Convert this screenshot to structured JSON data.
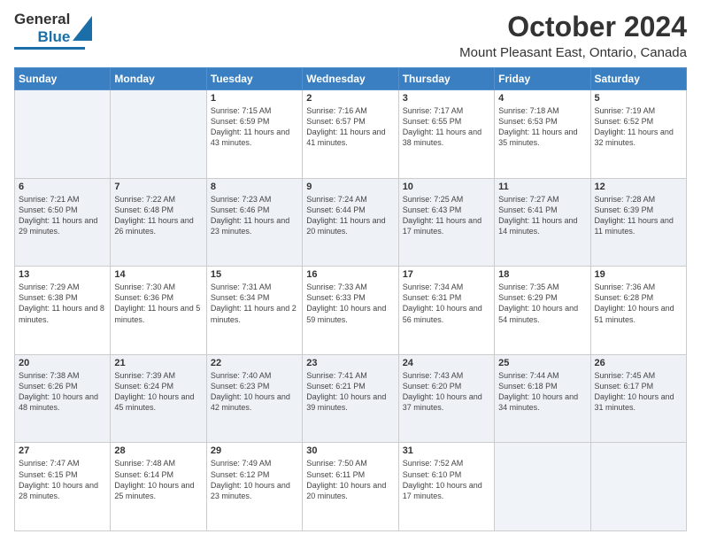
{
  "header": {
    "logo_general": "General",
    "logo_blue": "Blue",
    "month": "October 2024",
    "location": "Mount Pleasant East, Ontario, Canada"
  },
  "weekdays": [
    "Sunday",
    "Monday",
    "Tuesday",
    "Wednesday",
    "Thursday",
    "Friday",
    "Saturday"
  ],
  "rows": [
    [
      {
        "day": "",
        "content": ""
      },
      {
        "day": "",
        "content": ""
      },
      {
        "day": "1",
        "content": "Sunrise: 7:15 AM\nSunset: 6:59 PM\nDaylight: 11 hours and 43 minutes."
      },
      {
        "day": "2",
        "content": "Sunrise: 7:16 AM\nSunset: 6:57 PM\nDaylight: 11 hours and 41 minutes."
      },
      {
        "day": "3",
        "content": "Sunrise: 7:17 AM\nSunset: 6:55 PM\nDaylight: 11 hours and 38 minutes."
      },
      {
        "day": "4",
        "content": "Sunrise: 7:18 AM\nSunset: 6:53 PM\nDaylight: 11 hours and 35 minutes."
      },
      {
        "day": "5",
        "content": "Sunrise: 7:19 AM\nSunset: 6:52 PM\nDaylight: 11 hours and 32 minutes."
      }
    ],
    [
      {
        "day": "6",
        "content": "Sunrise: 7:21 AM\nSunset: 6:50 PM\nDaylight: 11 hours and 29 minutes."
      },
      {
        "day": "7",
        "content": "Sunrise: 7:22 AM\nSunset: 6:48 PM\nDaylight: 11 hours and 26 minutes."
      },
      {
        "day": "8",
        "content": "Sunrise: 7:23 AM\nSunset: 6:46 PM\nDaylight: 11 hours and 23 minutes."
      },
      {
        "day": "9",
        "content": "Sunrise: 7:24 AM\nSunset: 6:44 PM\nDaylight: 11 hours and 20 minutes."
      },
      {
        "day": "10",
        "content": "Sunrise: 7:25 AM\nSunset: 6:43 PM\nDaylight: 11 hours and 17 minutes."
      },
      {
        "day": "11",
        "content": "Sunrise: 7:27 AM\nSunset: 6:41 PM\nDaylight: 11 hours and 14 minutes."
      },
      {
        "day": "12",
        "content": "Sunrise: 7:28 AM\nSunset: 6:39 PM\nDaylight: 11 hours and 11 minutes."
      }
    ],
    [
      {
        "day": "13",
        "content": "Sunrise: 7:29 AM\nSunset: 6:38 PM\nDaylight: 11 hours and 8 minutes."
      },
      {
        "day": "14",
        "content": "Sunrise: 7:30 AM\nSunset: 6:36 PM\nDaylight: 11 hours and 5 minutes."
      },
      {
        "day": "15",
        "content": "Sunrise: 7:31 AM\nSunset: 6:34 PM\nDaylight: 11 hours and 2 minutes."
      },
      {
        "day": "16",
        "content": "Sunrise: 7:33 AM\nSunset: 6:33 PM\nDaylight: 10 hours and 59 minutes."
      },
      {
        "day": "17",
        "content": "Sunrise: 7:34 AM\nSunset: 6:31 PM\nDaylight: 10 hours and 56 minutes."
      },
      {
        "day": "18",
        "content": "Sunrise: 7:35 AM\nSunset: 6:29 PM\nDaylight: 10 hours and 54 minutes."
      },
      {
        "day": "19",
        "content": "Sunrise: 7:36 AM\nSunset: 6:28 PM\nDaylight: 10 hours and 51 minutes."
      }
    ],
    [
      {
        "day": "20",
        "content": "Sunrise: 7:38 AM\nSunset: 6:26 PM\nDaylight: 10 hours and 48 minutes."
      },
      {
        "day": "21",
        "content": "Sunrise: 7:39 AM\nSunset: 6:24 PM\nDaylight: 10 hours and 45 minutes."
      },
      {
        "day": "22",
        "content": "Sunrise: 7:40 AM\nSunset: 6:23 PM\nDaylight: 10 hours and 42 minutes."
      },
      {
        "day": "23",
        "content": "Sunrise: 7:41 AM\nSunset: 6:21 PM\nDaylight: 10 hours and 39 minutes."
      },
      {
        "day": "24",
        "content": "Sunrise: 7:43 AM\nSunset: 6:20 PM\nDaylight: 10 hours and 37 minutes."
      },
      {
        "day": "25",
        "content": "Sunrise: 7:44 AM\nSunset: 6:18 PM\nDaylight: 10 hours and 34 minutes."
      },
      {
        "day": "26",
        "content": "Sunrise: 7:45 AM\nSunset: 6:17 PM\nDaylight: 10 hours and 31 minutes."
      }
    ],
    [
      {
        "day": "27",
        "content": "Sunrise: 7:47 AM\nSunset: 6:15 PM\nDaylight: 10 hours and 28 minutes."
      },
      {
        "day": "28",
        "content": "Sunrise: 7:48 AM\nSunset: 6:14 PM\nDaylight: 10 hours and 25 minutes."
      },
      {
        "day": "29",
        "content": "Sunrise: 7:49 AM\nSunset: 6:12 PM\nDaylight: 10 hours and 23 minutes."
      },
      {
        "day": "30",
        "content": "Sunrise: 7:50 AM\nSunset: 6:11 PM\nDaylight: 10 hours and 20 minutes."
      },
      {
        "day": "31",
        "content": "Sunrise: 7:52 AM\nSunset: 6:10 PM\nDaylight: 10 hours and 17 minutes."
      },
      {
        "day": "",
        "content": ""
      },
      {
        "day": "",
        "content": ""
      }
    ]
  ],
  "row_shades": [
    "white",
    "shade",
    "white",
    "shade",
    "white"
  ]
}
